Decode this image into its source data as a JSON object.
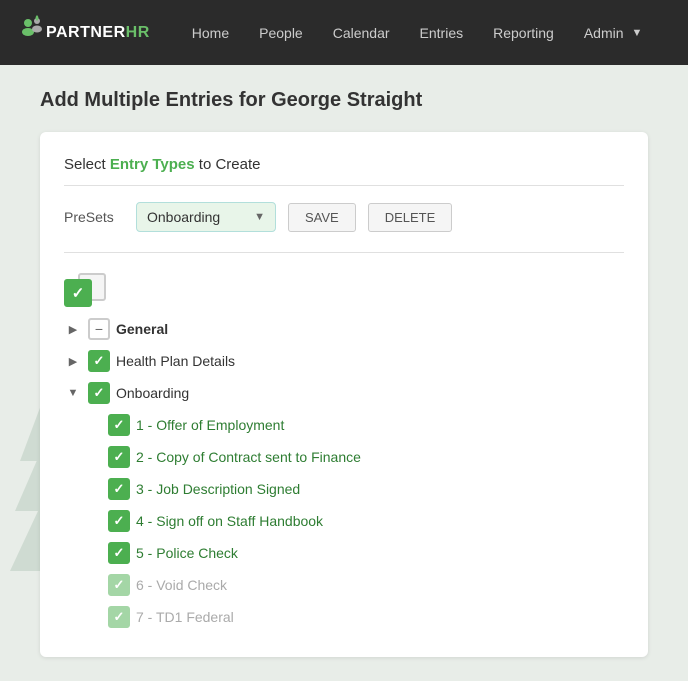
{
  "navbar": {
    "logo": "PARTNERHR",
    "logo_accent": "HR",
    "links": [
      {
        "label": "Home",
        "active": false
      },
      {
        "label": "People",
        "active": false
      },
      {
        "label": "Calendar",
        "active": false
      },
      {
        "label": "Entries",
        "active": false
      },
      {
        "label": "Reporting",
        "active": false
      },
      {
        "label": "Admin",
        "active": false,
        "dropdown": true
      }
    ]
  },
  "page": {
    "title": "Add Multiple Entries for George Straight"
  },
  "card": {
    "header": "Select Entry Types to Create",
    "header_accent": "Entry Types"
  },
  "presets": {
    "label": "PreSets",
    "selected": "Onboarding",
    "save_btn": "SAVE",
    "delete_btn": "DELETE"
  },
  "tree": {
    "items": [
      {
        "id": "general",
        "label": "General",
        "chevron": "right",
        "checkbox": "indeterminate",
        "label_style": "bold",
        "children": []
      },
      {
        "id": "health-plan",
        "label": "Health Plan Details",
        "chevron": "right",
        "checkbox": "checked",
        "label_style": "normal",
        "children": []
      },
      {
        "id": "onboarding",
        "label": "Onboarding",
        "chevron": "down",
        "checkbox": "checked",
        "label_style": "normal",
        "children": [
          {
            "label": "1 - Offer of Employment",
            "checked": true,
            "style": "green"
          },
          {
            "label": "2 - Copy of Contract sent to Finance",
            "checked": true,
            "style": "green"
          },
          {
            "label": "3 - Job Description Signed",
            "checked": true,
            "style": "green"
          },
          {
            "label": "4 - Sign off on Staff Handbook",
            "checked": true,
            "style": "green"
          },
          {
            "label": "5 - Police Check",
            "checked": true,
            "style": "green"
          },
          {
            "label": "6 - Void Check",
            "checked": true,
            "style": "gray"
          },
          {
            "label": "7 - TD1 Federal",
            "checked": true,
            "style": "gray"
          }
        ]
      }
    ]
  }
}
